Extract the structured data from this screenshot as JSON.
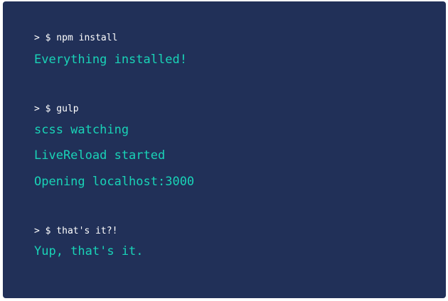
{
  "terminal": {
    "blocks": [
      {
        "command": "> $ npm install",
        "output": [
          "Everything installed!"
        ]
      },
      {
        "command": "> $ gulp",
        "output": [
          "scss watching",
          "LiveReload started",
          "Opening localhost:3000"
        ]
      },
      {
        "command": "> $ that's it?!",
        "output": [
          "Yup, that's it."
        ]
      }
    ]
  },
  "colors": {
    "background": "#213058",
    "command_text": "#ffffff",
    "output_text": "#19d3b7"
  }
}
